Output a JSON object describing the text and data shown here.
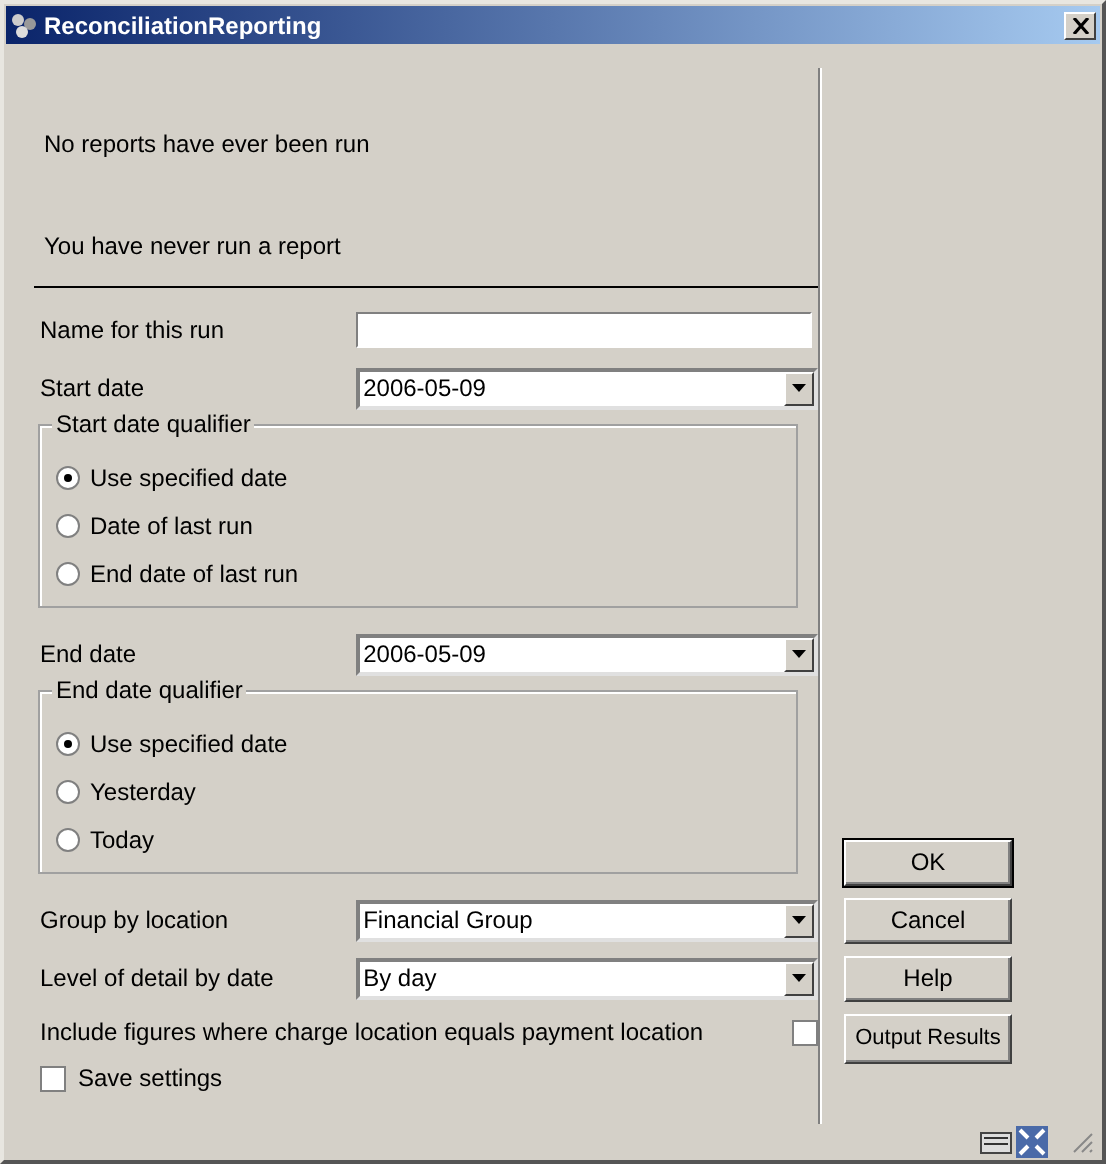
{
  "window": {
    "title": "ReconciliationReporting"
  },
  "messages": [
    "No reports have ever been run",
    "You have never run a report"
  ],
  "form": [
    {
      "kind": "text",
      "label": "Name for this run"
    },
    {
      "kind": "dropdown",
      "label": "Start date",
      "value": "2006-05-09"
    },
    {
      "kind": "group",
      "legend": "Start date qualifier",
      "options": [
        {
          "label": "Use specified date",
          "selected": true
        },
        {
          "label": "Date of last run",
          "selected": false
        },
        {
          "label": "End date of last run",
          "selected": false
        }
      ]
    },
    {
      "kind": "dropdown",
      "label": "End date",
      "value": "2006-05-09"
    },
    {
      "kind": "group",
      "legend": "End date qualifier",
      "options": [
        {
          "label": "Use specified date",
          "selected": true
        },
        {
          "label": "Yesterday",
          "selected": false
        },
        {
          "label": "Today",
          "selected": false
        }
      ]
    },
    {
      "kind": "dropdown",
      "label": "Group by location",
      "value": "Financial Group"
    },
    {
      "kind": "dropdown",
      "label": "Level of detail by date",
      "value": "By day"
    },
    {
      "kind": "check-right",
      "label": "Include figures where charge location equals payment location",
      "checked": false
    },
    {
      "kind": "check-left",
      "label": "Save settings",
      "checked": false
    }
  ],
  "buttons": [
    {
      "label": "OK",
      "default": true
    },
    {
      "label": "Cancel",
      "default": false
    },
    {
      "label": "Help",
      "default": false
    },
    {
      "label": "Output Results",
      "default": false
    }
  ]
}
